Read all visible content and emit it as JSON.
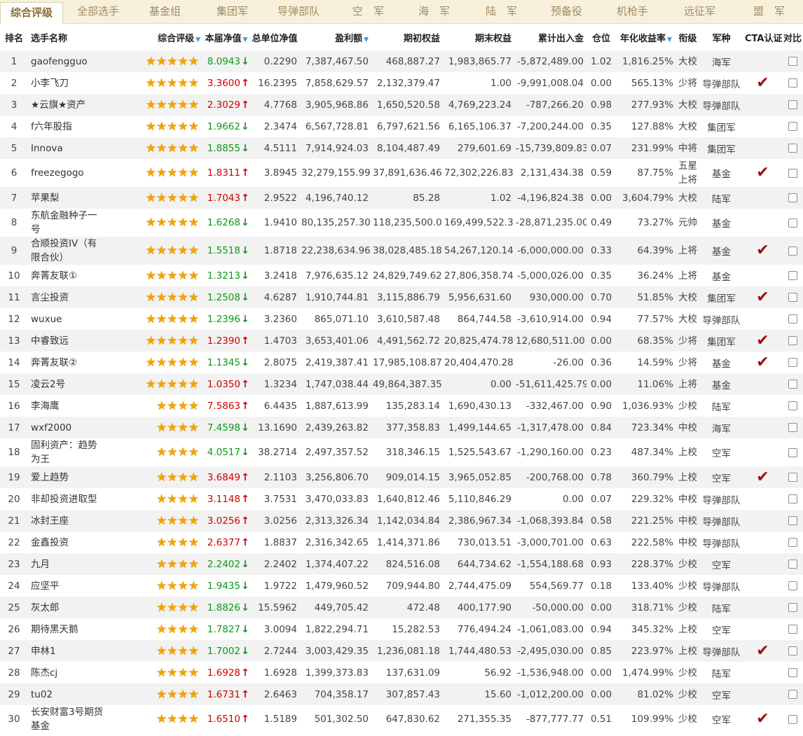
{
  "tabs": [
    "综合评级",
    "全部选手",
    "基金组",
    "集团军",
    "导弹部队",
    "空　军",
    "海　军",
    "陆　军",
    "预备役",
    "机枪手",
    "远征军",
    "盟　军"
  ],
  "headers": {
    "rank": "排名",
    "name": "选手名称",
    "rating": "综合评级",
    "nav": "本届净值",
    "unit_nav": "总单位净值",
    "profit": "盈利额",
    "start_equity": "期初权益",
    "end_equity": "期末权益",
    "inout": "累计出入金",
    "position": "仓位",
    "annual": "年化收益率",
    "level": "衔级",
    "arm": "军种",
    "cta": "CTA认证",
    "compare": "对比"
  },
  "sort_indicator": "▼",
  "icons": {
    "up": "arrow-up-icon",
    "down": "arrow-down-icon",
    "star": "star-icon",
    "check": "cta-check-icon"
  },
  "colors": {
    "up": "#d20000",
    "down": "#0a9a16",
    "star": "#f4a400",
    "check": "#9b1313",
    "sort": "#3a9ad9"
  },
  "rows": [
    {
      "rank": "1",
      "name": "gaofengguo",
      "stars": 5,
      "nav": "8.0943",
      "dir": "down",
      "unit_nav": "0.2290",
      "profit": "7,387,467.50",
      "start": "468,887.27",
      "end": "1,983,865.77",
      "inout": "-5,872,489.00",
      "pos": "1.02",
      "annual": "1,816.25%",
      "level": "大校",
      "arm": "海军",
      "cta": false
    },
    {
      "rank": "2",
      "name": "小李飞刀",
      "stars": 5,
      "nav": "3.3600",
      "dir": "up",
      "unit_nav": "16.2395",
      "profit": "7,858,629.57",
      "start": "2,132,379.47",
      "end": "1.00",
      "inout": "-9,991,008.04",
      "pos": "0.00",
      "annual": "565.13%",
      "level": "少将",
      "arm": "导弹部队",
      "cta": true
    },
    {
      "rank": "3",
      "name": "★云旗★资产",
      "stars": 5,
      "nav": "2.3029",
      "dir": "up",
      "unit_nav": "4.7768",
      "profit": "3,905,968.86",
      "start": "1,650,520.58",
      "end": "4,769,223.24",
      "inout": "-787,266.20",
      "pos": "0.98",
      "annual": "277.93%",
      "level": "大校",
      "arm": "导弹部队",
      "cta": false
    },
    {
      "rank": "4",
      "name": "f六年股指",
      "stars": 5,
      "nav": "1.9662",
      "dir": "down",
      "unit_nav": "2.3474",
      "profit": "6,567,728.81",
      "start": "6,797,621.56",
      "end": "6,165,106.37",
      "inout": "-7,200,244.00",
      "pos": "0.35",
      "annual": "127.88%",
      "level": "大校",
      "arm": "集团军",
      "cta": false
    },
    {
      "rank": "5",
      "name": "Innova",
      "stars": 5,
      "nav": "1.8855",
      "dir": "down",
      "unit_nav": "4.5111",
      "profit": "7,914,924.03",
      "start": "8,104,487.49",
      "end": "279,601.69",
      "inout": "-15,739,809.83",
      "pos": "0.07",
      "annual": "231.99%",
      "level": "中将",
      "arm": "集团军",
      "cta": false
    },
    {
      "rank": "6",
      "name": "freezegogo",
      "stars": 5,
      "nav": "1.8311",
      "dir": "up",
      "unit_nav": "3.8945",
      "profit": "32,279,155.99",
      "start": "37,891,636.46",
      "end": "72,302,226.83",
      "inout": "2,131,434.38",
      "pos": "0.59",
      "annual": "87.75%",
      "level": "五星上将",
      "arm": "基金",
      "cta": true
    },
    {
      "rank": "7",
      "name": "苹果梨",
      "stars": 5,
      "nav": "1.7043",
      "dir": "up",
      "unit_nav": "2.9522",
      "profit": "4,196,740.12",
      "start": "85.28",
      "end": "1.02",
      "inout": "-4,196,824.38",
      "pos": "0.00",
      "annual": "3,604.79%",
      "level": "大校",
      "arm": "陆军",
      "cta": false
    },
    {
      "rank": "8",
      "name": "东航金融种子一号",
      "stars": 5,
      "nav": "1.6268",
      "dir": "down",
      "unit_nav": "1.9410",
      "profit": "80,135,257.30",
      "start": "118,235,500.01",
      "end": "169,499,522.31",
      "inout": "-28,871,235.00",
      "pos": "0.49",
      "annual": "73.27%",
      "level": "元帅",
      "arm": "基金",
      "cta": false
    },
    {
      "rank": "9",
      "name": "合顺投资IV（有限合伙）",
      "stars": 5,
      "nav": "1.5518",
      "dir": "down",
      "unit_nav": "1.8718",
      "profit": "22,238,634.96",
      "start": "38,028,485.18",
      "end": "54,267,120.14",
      "inout": "-6,000,000.00",
      "pos": "0.33",
      "annual": "64.39%",
      "level": "上将",
      "arm": "基金",
      "cta": true
    },
    {
      "rank": "10",
      "name": "奔菁友联①",
      "stars": 5,
      "nav": "1.3213",
      "dir": "down",
      "unit_nav": "3.2418",
      "profit": "7,976,635.12",
      "start": "24,829,749.62",
      "end": "27,806,358.74",
      "inout": "-5,000,026.00",
      "pos": "0.35",
      "annual": "36.24%",
      "level": "上将",
      "arm": "基金",
      "cta": false
    },
    {
      "rank": "11",
      "name": "言尘投资",
      "stars": 5,
      "nav": "1.2508",
      "dir": "down",
      "unit_nav": "4.6287",
      "profit": "1,910,744.81",
      "start": "3,115,886.79",
      "end": "5,956,631.60",
      "inout": "930,000.00",
      "pos": "0.70",
      "annual": "51.85%",
      "level": "大校",
      "arm": "集团军",
      "cta": true
    },
    {
      "rank": "12",
      "name": "wuxue",
      "stars": 5,
      "nav": "1.2396",
      "dir": "down",
      "unit_nav": "3.2360",
      "profit": "865,071.10",
      "start": "3,610,587.48",
      "end": "864,744.58",
      "inout": "-3,610,914.00",
      "pos": "0.94",
      "annual": "77.57%",
      "level": "大校",
      "arm": "导弹部队",
      "cta": false
    },
    {
      "rank": "13",
      "name": "中睿致远",
      "stars": 5,
      "nav": "1.2390",
      "dir": "up",
      "unit_nav": "1.4703",
      "profit": "3,653,401.06",
      "start": "4,491,562.72",
      "end": "20,825,474.78",
      "inout": "12,680,511.00",
      "pos": "0.00",
      "annual": "68.35%",
      "level": "少将",
      "arm": "集团军",
      "cta": true
    },
    {
      "rank": "14",
      "name": "奔菁友联②",
      "stars": 5,
      "nav": "1.1345",
      "dir": "down",
      "unit_nav": "2.8075",
      "profit": "2,419,387.41",
      "start": "17,985,108.87",
      "end": "20,404,470.28",
      "inout": "-26.00",
      "pos": "0.36",
      "annual": "14.59%",
      "level": "少将",
      "arm": "基金",
      "cta": true
    },
    {
      "rank": "15",
      "name": "凌云2号",
      "stars": 5,
      "nav": "1.0350",
      "dir": "up",
      "unit_nav": "1.3234",
      "profit": "1,747,038.44",
      "start": "49,864,387.35",
      "end": "0.00",
      "inout": "-51,611,425.79",
      "pos": "0.00",
      "annual": "11.06%",
      "level": "上将",
      "arm": "基金",
      "cta": false
    },
    {
      "rank": "16",
      "name": "李海鹰",
      "stars": 4,
      "nav": "7.5863",
      "dir": "up",
      "unit_nav": "6.4435",
      "profit": "1,887,613.99",
      "start": "135,283.14",
      "end": "1,690,430.13",
      "inout": "-332,467.00",
      "pos": "0.90",
      "annual": "1,036.93%",
      "level": "少校",
      "arm": "陆军",
      "cta": false
    },
    {
      "rank": "17",
      "name": "wxf2000",
      "stars": 4,
      "nav": "7.4598",
      "dir": "down",
      "unit_nav": "13.1690",
      "profit": "2,439,263.82",
      "start": "377,358.83",
      "end": "1,499,144.65",
      "inout": "-1,317,478.00",
      "pos": "0.84",
      "annual": "723.34%",
      "level": "中校",
      "arm": "海军",
      "cta": false
    },
    {
      "rank": "18",
      "name": "固利资产：趋势为王",
      "stars": 4,
      "nav": "4.0517",
      "dir": "down",
      "unit_nav": "38.2714",
      "profit": "2,497,357.52",
      "start": "318,346.15",
      "end": "1,525,543.67",
      "inout": "-1,290,160.00",
      "pos": "0.23",
      "annual": "487.34%",
      "level": "上校",
      "arm": "空军",
      "cta": false
    },
    {
      "rank": "19",
      "name": "爱上趋势",
      "stars": 4,
      "nav": "3.6849",
      "dir": "up",
      "unit_nav": "2.1103",
      "profit": "3,256,806.70",
      "start": "909,014.15",
      "end": "3,965,052.85",
      "inout": "-200,768.00",
      "pos": "0.78",
      "annual": "360.79%",
      "level": "上校",
      "arm": "空军",
      "cta": true
    },
    {
      "rank": "20",
      "name": "非却投资进取型",
      "stars": 4,
      "nav": "3.1148",
      "dir": "up",
      "unit_nav": "3.7531",
      "profit": "3,470,033.83",
      "start": "1,640,812.46",
      "end": "5,110,846.29",
      "inout": "0.00",
      "pos": "0.07",
      "annual": "229.32%",
      "level": "中校",
      "arm": "导弹部队",
      "cta": false
    },
    {
      "rank": "21",
      "name": "冰封王座",
      "stars": 4,
      "nav": "3.0256",
      "dir": "up",
      "unit_nav": "3.0256",
      "profit": "2,313,326.34",
      "start": "1,142,034.84",
      "end": "2,386,967.34",
      "inout": "-1,068,393.84",
      "pos": "0.58",
      "annual": "221.25%",
      "level": "中校",
      "arm": "导弹部队",
      "cta": false
    },
    {
      "rank": "22",
      "name": "金鑫投资",
      "stars": 4,
      "nav": "2.6377",
      "dir": "up",
      "unit_nav": "1.8837",
      "profit": "2,316,342.65",
      "start": "1,414,371.86",
      "end": "730,013.51",
      "inout": "-3,000,701.00",
      "pos": "0.63",
      "annual": "222.58%",
      "level": "中校",
      "arm": "导弹部队",
      "cta": false
    },
    {
      "rank": "23",
      "name": "九月",
      "stars": 4,
      "nav": "2.2402",
      "dir": "down",
      "unit_nav": "2.2402",
      "profit": "1,374,407.22",
      "start": "824,516.08",
      "end": "644,734.62",
      "inout": "-1,554,188.68",
      "pos": "0.93",
      "annual": "228.37%",
      "level": "少校",
      "arm": "空军",
      "cta": false
    },
    {
      "rank": "24",
      "name": "应坚平",
      "stars": 4,
      "nav": "1.9435",
      "dir": "down",
      "unit_nav": "1.9722",
      "profit": "1,479,960.52",
      "start": "709,944.80",
      "end": "2,744,475.09",
      "inout": "554,569.77",
      "pos": "0.18",
      "annual": "133.40%",
      "level": "少校",
      "arm": "导弹部队",
      "cta": false
    },
    {
      "rank": "25",
      "name": "灰太郎",
      "stars": 4,
      "nav": "1.8826",
      "dir": "down",
      "unit_nav": "15.5962",
      "profit": "449,705.42",
      "start": "472.48",
      "end": "400,177.90",
      "inout": "-50,000.00",
      "pos": "0.00",
      "annual": "318.71%",
      "level": "少校",
      "arm": "陆军",
      "cta": false
    },
    {
      "rank": "26",
      "name": "期待黑天鹅",
      "stars": 4,
      "nav": "1.7827",
      "dir": "down",
      "unit_nav": "3.0094",
      "profit": "1,822,294.71",
      "start": "15,282.53",
      "end": "776,494.24",
      "inout": "-1,061,083.00",
      "pos": "0.94",
      "annual": "345.32%",
      "level": "上校",
      "arm": "空军",
      "cta": false
    },
    {
      "rank": "27",
      "name": "申林1",
      "stars": 4,
      "nav": "1.7002",
      "dir": "down",
      "unit_nav": "2.7244",
      "profit": "3,003,429.35",
      "start": "1,236,081.18",
      "end": "1,744,480.53",
      "inout": "-2,495,030.00",
      "pos": "0.85",
      "annual": "223.97%",
      "level": "上校",
      "arm": "导弹部队",
      "cta": true
    },
    {
      "rank": "28",
      "name": "陈杰cj",
      "stars": 4,
      "nav": "1.6928",
      "dir": "up",
      "unit_nav": "1.6928",
      "profit": "1,399,373.83",
      "start": "137,631.09",
      "end": "56.92",
      "inout": "-1,536,948.00",
      "pos": "0.00",
      "annual": "1,474.99%",
      "level": "少校",
      "arm": "陆军",
      "cta": false
    },
    {
      "rank": "29",
      "name": "tu02",
      "stars": 4,
      "nav": "1.6731",
      "dir": "up",
      "unit_nav": "2.6463",
      "profit": "704,358.17",
      "start": "307,857.43",
      "end": "15.60",
      "inout": "-1,012,200.00",
      "pos": "0.00",
      "annual": "81.02%",
      "level": "少校",
      "arm": "空军",
      "cta": false
    },
    {
      "rank": "30",
      "name": "长安财富3号期货基金",
      "stars": 4,
      "nav": "1.6510",
      "dir": "up",
      "unit_nav": "1.5189",
      "profit": "501,302.50",
      "start": "647,830.62",
      "end": "271,355.35",
      "inout": "-877,777.77",
      "pos": "0.51",
      "annual": "109.99%",
      "level": "少校",
      "arm": "空军",
      "cta": true
    }
  ]
}
